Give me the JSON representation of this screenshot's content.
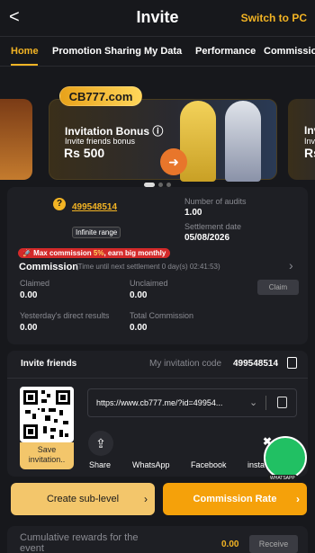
{
  "header": {
    "back": "<",
    "title": "Invite",
    "switch_pc": "Switch to PC"
  },
  "tabs": [
    {
      "label": "Home",
      "active": true
    },
    {
      "label": "Promotion Sharing"
    },
    {
      "label": "My Data"
    },
    {
      "label": "Performance"
    },
    {
      "label": "Commission"
    }
  ],
  "banner": {
    "logo": "CB777.com",
    "title": "Invitation Bonus ⓘ",
    "subtitle": "Invite friends bonus",
    "amount": "Rs 500",
    "right_title": "Invi",
    "right_sub": "Invite",
    "right_amount": "Rs",
    "slides": [
      {
        "active": true
      },
      {},
      {}
    ]
  },
  "account": {
    "help": "?",
    "uid": "499548514",
    "range": "Infinite range",
    "audits_label": "Number of audits",
    "audits_value": "1.00",
    "settlement_label": "Settlement date",
    "settlement_value": "05/08/2026"
  },
  "commission": {
    "max_badge_prefix": "🚀 Max commission ",
    "max_badge_value": "5%",
    "max_badge_suffix": ", earn big monthly",
    "title": "Commission",
    "time_note": "(Time until next settlement  0 day(s) 02:41:53)",
    "chevron": "›",
    "claimed_label": "Claimed",
    "claimed_value": "0.00",
    "unclaimed_label": "Unclaimed",
    "unclaimed_value": "0.00",
    "claim_button": "Claim",
    "yesterday_label": "Yesterday's direct results",
    "yesterday_value": "0.00",
    "total_label": "Total Commission",
    "total_value": "0.00"
  },
  "invite": {
    "title": "Invite friends",
    "code_label": "My invitation code",
    "code_value": "499548514",
    "save_label": "Save invitation..",
    "link": "https://www.cb777.me/?id=49954...",
    "link_chevron": "⌄",
    "share_label": "Share",
    "whatsapp_label": "WhatsApp",
    "facebook_label": "Facebook",
    "insta_label": "insta",
    "float_x": "✖",
    "float_label": "WHATSAPP"
  },
  "actions": {
    "sublevel": "Create sub-level",
    "rate": "Commission Rate",
    "chevron": "›"
  },
  "rewards": {
    "label": "Cumulative rewards for the event",
    "value": "0.00",
    "receive": "Receive"
  }
}
